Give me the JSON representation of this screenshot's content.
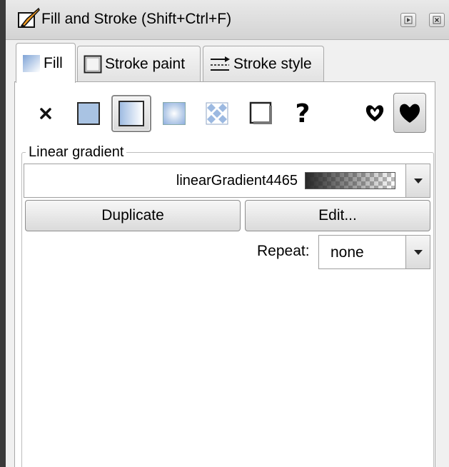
{
  "window": {
    "title": "Fill and Stroke (Shift+Ctrl+F)",
    "icons": {
      "app": "fill-stroke-brush-icon",
      "float": "float-dock-icon",
      "close": "close-icon"
    }
  },
  "tabs": [
    {
      "label": "Fill",
      "icon": "fill-icon",
      "active": true
    },
    {
      "label": "Stroke paint",
      "icon": "stroke-paint-icon",
      "active": false
    },
    {
      "label": "Stroke style",
      "icon": "stroke-style-icon",
      "active": false
    }
  ],
  "paint_types": [
    {
      "name": "no-paint",
      "icon": "x-icon"
    },
    {
      "name": "flat-color",
      "icon": "flat-color-icon"
    },
    {
      "name": "linear-gradient",
      "icon": "linear-gradient-icon",
      "selected": true
    },
    {
      "name": "radial-gradient",
      "icon": "radial-gradient-icon"
    },
    {
      "name": "pattern",
      "icon": "pattern-icon"
    },
    {
      "name": "swatch",
      "icon": "swatch-icon"
    },
    {
      "name": "unset",
      "icon": "question-icon"
    }
  ],
  "fill_rules": [
    {
      "name": "evenodd",
      "icon": "fill-rule-evenodd-icon"
    },
    {
      "name": "nonzero",
      "icon": "fill-rule-nonzero-icon",
      "selected": true
    }
  ],
  "gradient": {
    "section_label": "Linear gradient",
    "selected_name": "linearGradient4465",
    "duplicate_label": "Duplicate",
    "edit_label": "Edit...",
    "repeat_label": "Repeat:",
    "repeat_value": "none"
  },
  "colors": {
    "flat": "#a9c3e3",
    "titlebar": "#dcdcdc",
    "panel": "#f0f0f0"
  }
}
